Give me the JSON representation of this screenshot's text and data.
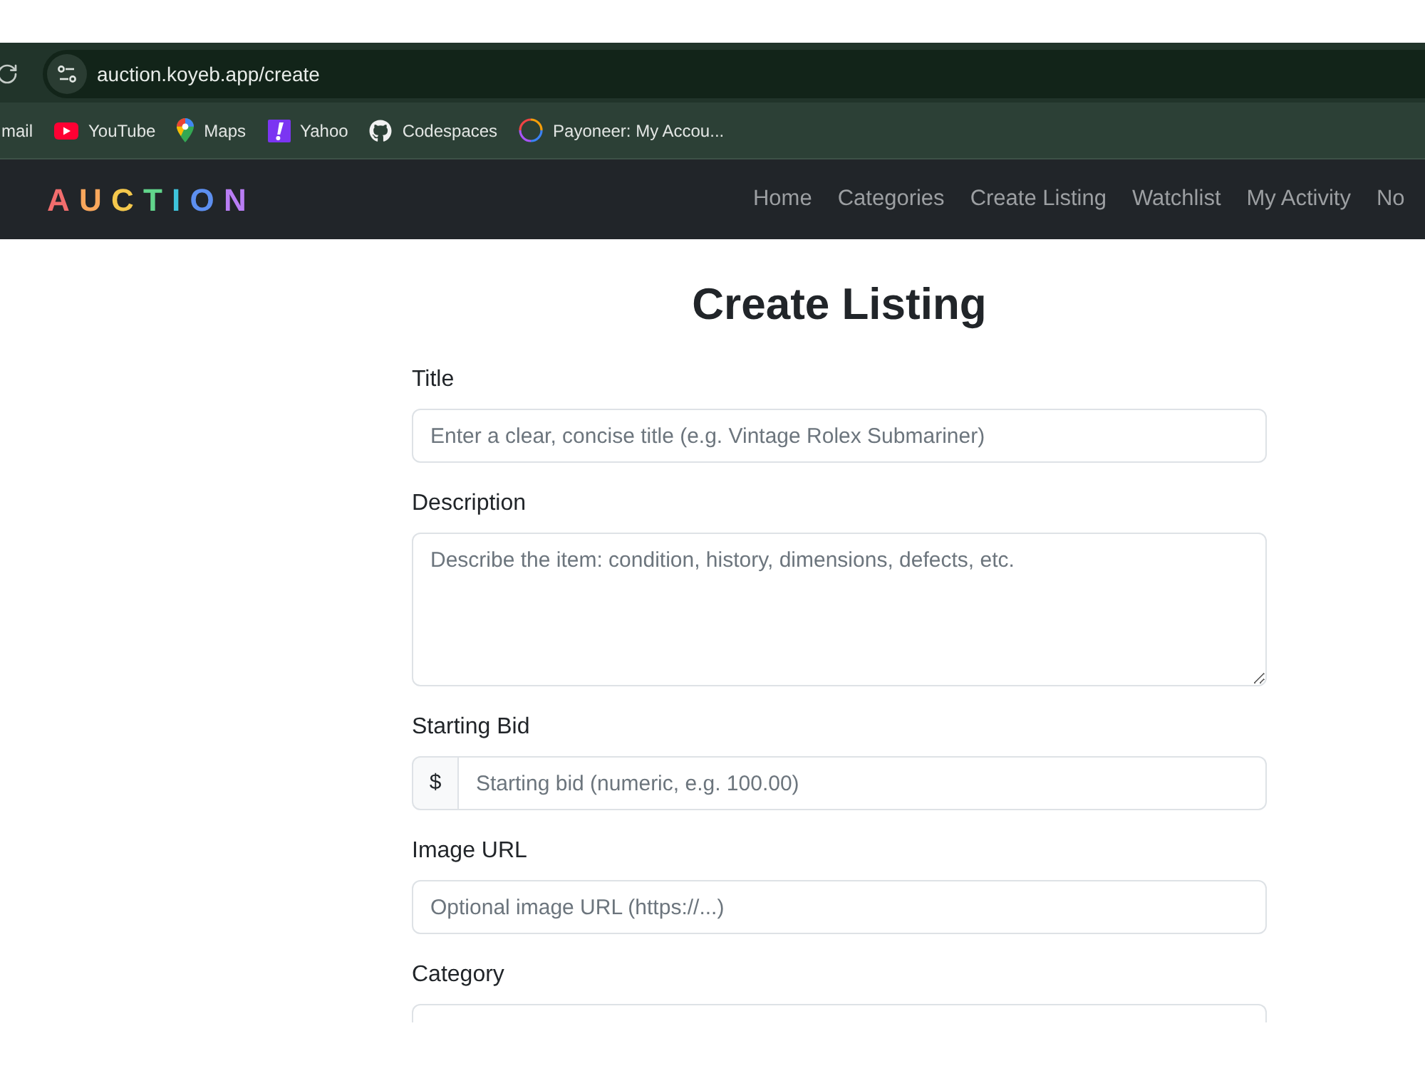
{
  "browser": {
    "url": "auction.koyeb.app/create",
    "bookmarks": [
      {
        "label": "mail",
        "kind": "text"
      },
      {
        "label": "YouTube",
        "kind": "play"
      },
      {
        "label": "Maps",
        "kind": "pin"
      },
      {
        "label": "Yahoo",
        "kind": "exclaim"
      },
      {
        "label": "Codespaces",
        "kind": "cat"
      },
      {
        "label": "Payoneer: My Accou...",
        "kind": "ring"
      }
    ]
  },
  "navbar": {
    "logo": "AUCTION",
    "links": [
      "Home",
      "Categories",
      "Create Listing",
      "Watchlist",
      "My Activity",
      "No"
    ]
  },
  "page": {
    "heading": "Create Listing",
    "fields": [
      {
        "label": "Title",
        "kind": "input",
        "placeholder": "Enter a clear, concise title (e.g. Vintage Rolex Submariner)"
      },
      {
        "label": "Description",
        "kind": "textarea",
        "placeholder": "Describe the item: condition, history, dimensions, defects, etc."
      },
      {
        "label": "Starting Bid",
        "kind": "currency",
        "prefix": "$",
        "placeholder": "Starting bid (numeric, e.g. 100.00)"
      },
      {
        "label": "Image URL",
        "kind": "input",
        "placeholder": "Optional image URL (https://...)"
      },
      {
        "label": "Category",
        "kind": "select"
      }
    ]
  }
}
